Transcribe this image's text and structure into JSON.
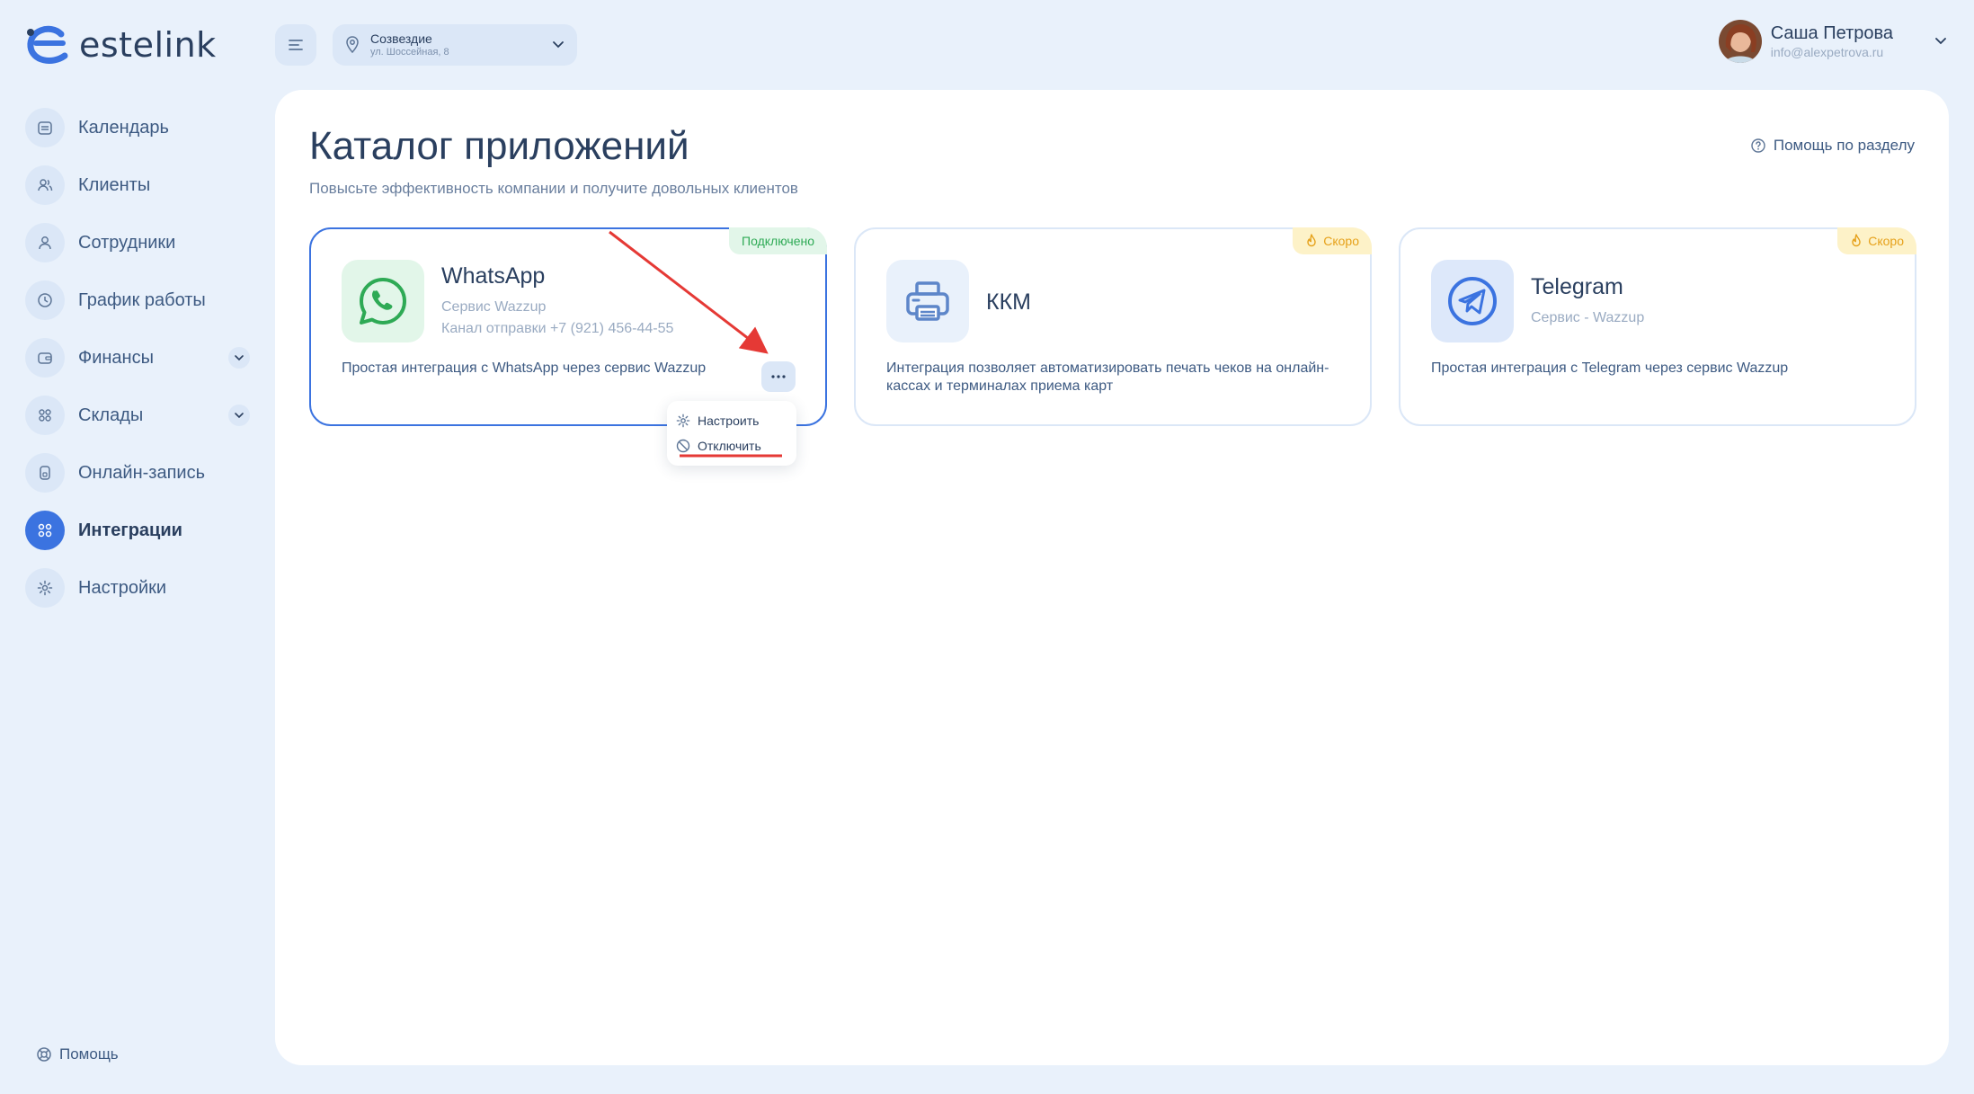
{
  "brand": {
    "name": "estelink"
  },
  "location": {
    "name": "Созвездие",
    "address": "ул. Шоссейная, 8"
  },
  "user": {
    "name": "Саша Петрова",
    "email": "info@alexpetrova.ru"
  },
  "sidebar": {
    "items": [
      {
        "label": "Календарь",
        "icon": "calendar-icon"
      },
      {
        "label": "Клиенты",
        "icon": "clients-icon"
      },
      {
        "label": "Сотрудники",
        "icon": "employee-icon"
      },
      {
        "label": "График работы",
        "icon": "clock-icon"
      },
      {
        "label": "Финансы",
        "icon": "wallet-icon",
        "expandable": true
      },
      {
        "label": "Склады",
        "icon": "warehouse-icon",
        "expandable": true
      },
      {
        "label": "Онлайн-запись",
        "icon": "phone-icon"
      },
      {
        "label": "Интеграции",
        "icon": "apps-icon",
        "active": true
      },
      {
        "label": "Настройки",
        "icon": "gear-icon"
      }
    ],
    "help_label": "Помощь"
  },
  "main": {
    "title": "Каталог приложений",
    "subtitle": "Повысьте эффективность компании и получите довольных клиентов",
    "section_help": "Помощь по разделу"
  },
  "cards": [
    {
      "title": "WhatsApp",
      "sub1": "Сервис Wazzup",
      "sub2": "Канал отправки +7 (921) 456-44-55",
      "description": "Простая интеграция с WhatsApp через сервис Wazzup",
      "badge": "Подключено",
      "badge_color": "#2eaa55"
    },
    {
      "title": "ККМ",
      "description": "Интеграция позволяет автоматизировать печать чеков на онлайн-кассах и терминалах приема карт",
      "badge": "Скоро",
      "badge_color": "#e6a11a"
    },
    {
      "title": "Telegram",
      "sub1": "Сервис - Wazzup",
      "description": "Простая интеграция с Telegram через сервис Wazzup",
      "badge": "Скоро",
      "badge_color": "#e6a11a"
    }
  ],
  "dropdown": {
    "items": [
      {
        "label": "Настроить",
        "icon": "gear-icon"
      },
      {
        "label": "Отключить",
        "icon": "block-icon"
      }
    ]
  },
  "colors": {
    "accent": "#3b73e0",
    "annotation": "#e53935"
  }
}
